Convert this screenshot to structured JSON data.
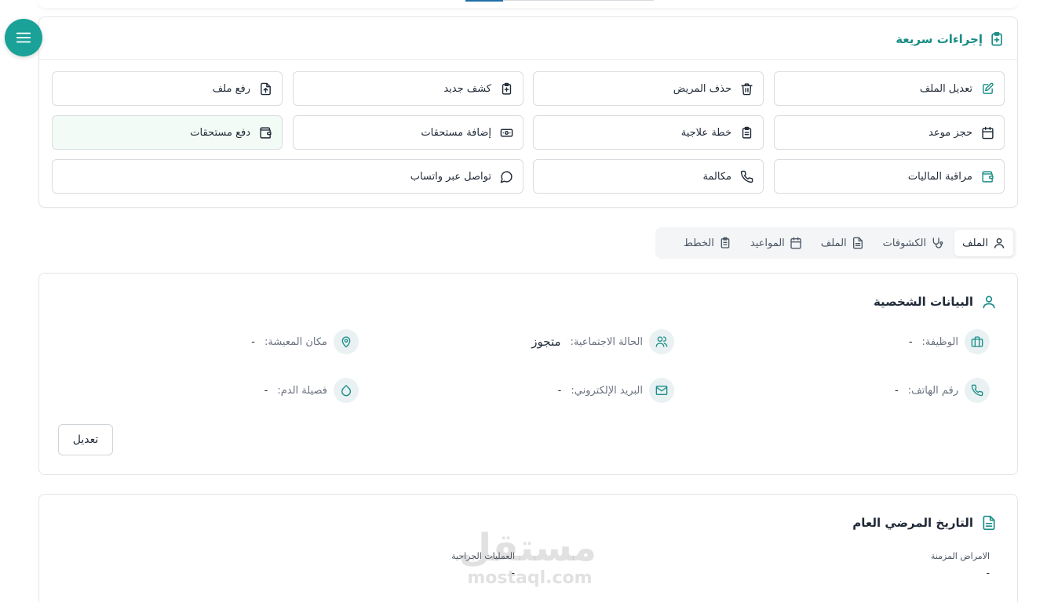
{
  "quick_actions": {
    "title": "إجراءات سريعة",
    "buttons": [
      {
        "label": "تعديل الملف",
        "icon": "pencil-square-icon"
      },
      {
        "label": "حذف المريض",
        "icon": "trash-icon"
      },
      {
        "label": "كشف جديد",
        "icon": "clipboard-plus-icon"
      },
      {
        "label": "رفع ملف",
        "icon": "file-upload-icon"
      },
      {
        "label": "حجز موعد",
        "icon": "calendar-icon"
      },
      {
        "label": "خطة علاجية",
        "icon": "clipboard-list-icon"
      },
      {
        "label": "إضافة مستحقات",
        "icon": "banknote-icon"
      },
      {
        "label": "دفع مستحقات",
        "icon": "wallet-icon"
      },
      {
        "label": "مراقبة الماليات",
        "icon": "wallet-icon"
      },
      {
        "label": "مكالمة",
        "icon": "phone-icon"
      },
      {
        "label": "تواصل عبر واتساب",
        "icon": "chat-bubble-icon"
      }
    ]
  },
  "tabs": [
    {
      "label": "الملف",
      "icon": "user-icon",
      "active": true
    },
    {
      "label": "الكشوفات",
      "icon": "stethoscope-icon",
      "active": false
    },
    {
      "label": "الملف",
      "icon": "file-text-icon",
      "active": false
    },
    {
      "label": "المواعيد",
      "icon": "calendar-icon",
      "active": false
    },
    {
      "label": "الخطط",
      "icon": "clipboard-list-icon",
      "active": false
    }
  ],
  "personal": {
    "title": "البيانات الشخصية",
    "job": {
      "label": "الوظيفة:",
      "value": "-"
    },
    "marital": {
      "label": "الحالة الاجتماعية:",
      "value": "متجوز"
    },
    "residence": {
      "label": "مكان المعيشة:",
      "value": "-"
    },
    "phone": {
      "label": "رقم الهاتف:",
      "value": "-"
    },
    "email": {
      "label": "البريد الإلكتروني:",
      "value": "-"
    },
    "blood": {
      "label": "فصيلة الدم:",
      "value": "-"
    },
    "edit_label": "تعديل"
  },
  "history": {
    "title": "التاريخ المرضي العام",
    "chronic": {
      "label": "الامراض المزمنة",
      "value": "-"
    },
    "surgeries": {
      "label": "العمليات الجراحية",
      "value": "-"
    }
  },
  "watermark": {
    "arabic": "مستقل",
    "latin": "mostaql.com"
  },
  "colors": {
    "brand_teal": "#1aa198",
    "accent_teal": "#1a8d86",
    "highlight_bg": "#f3fbf6"
  }
}
